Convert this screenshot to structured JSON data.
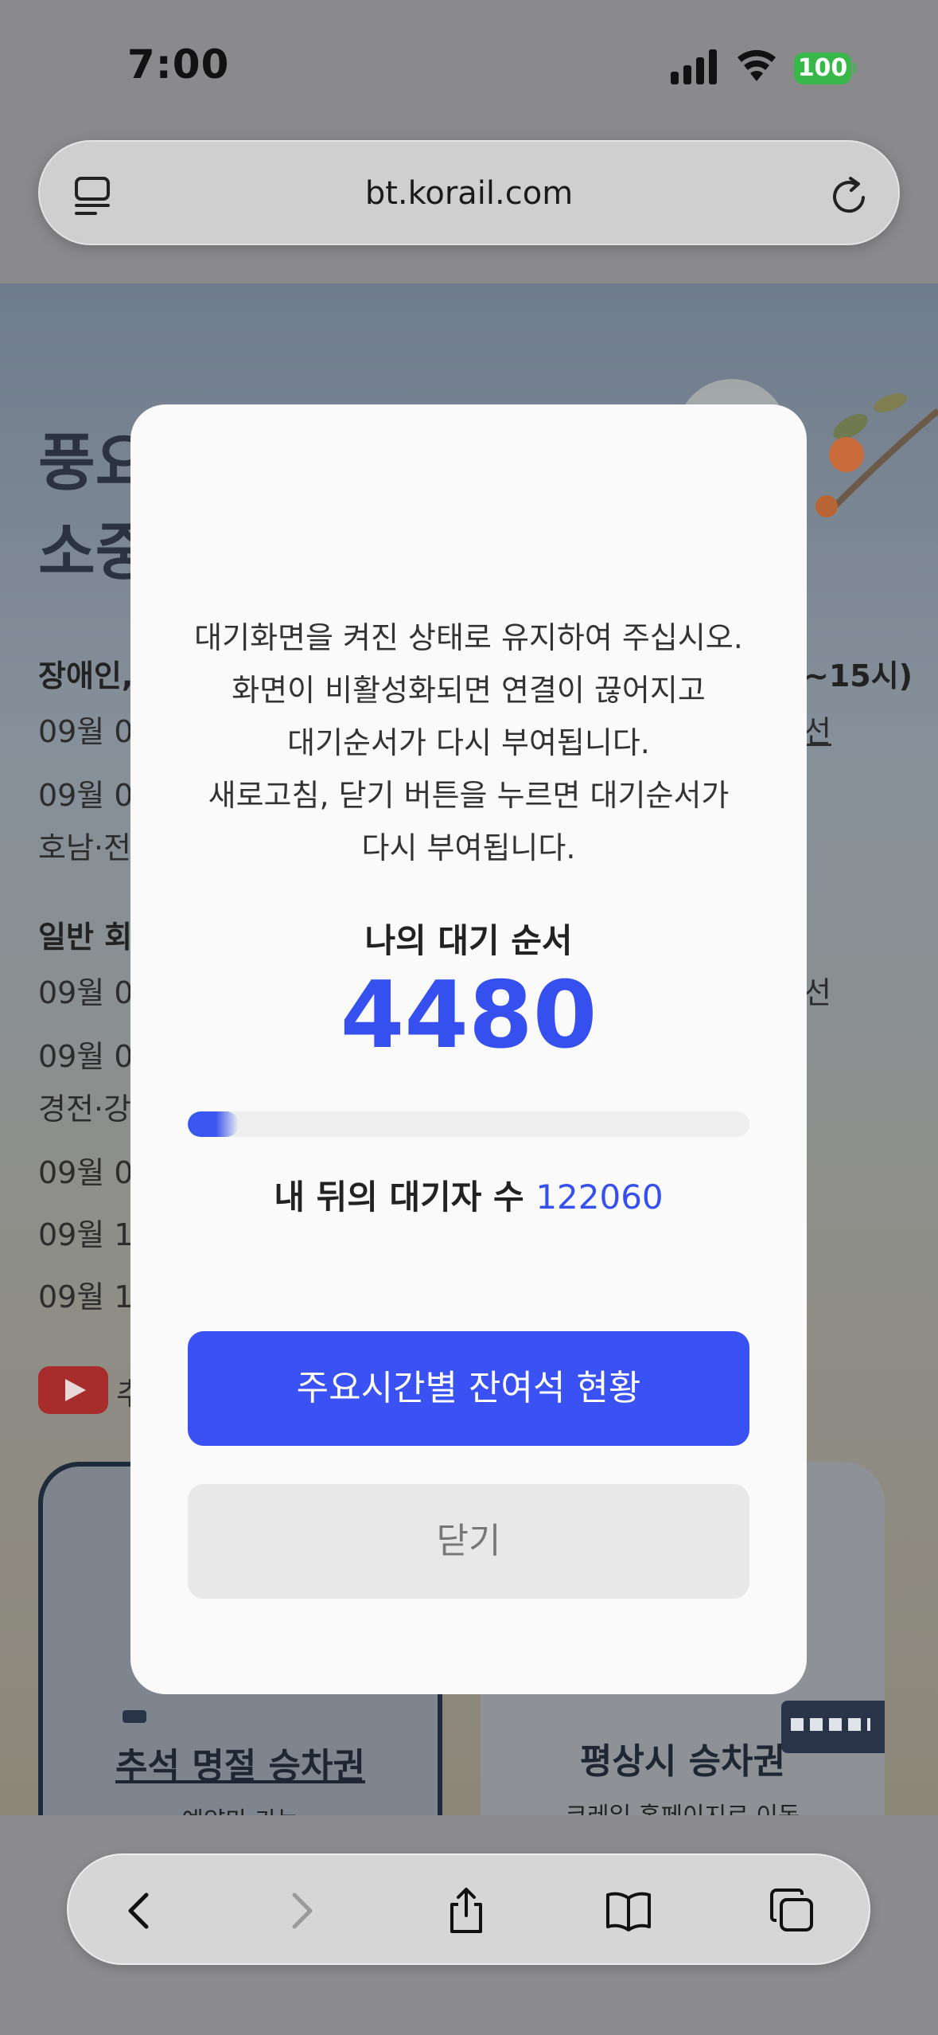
{
  "status_bar": {
    "time": "7:00",
    "battery": "100"
  },
  "browser": {
    "url": "bt.korail.com"
  },
  "background_page": {
    "hero_title_lines": [
      "풍요",
      "소중"
    ],
    "lines_left": [
      {
        "text": "장애인,",
        "bold": true
      },
      {
        "text": "09월 03",
        "bold": false
      },
      {
        "text": "09월 04",
        "bold": false
      },
      {
        "text": "호남·전",
        "bold": false
      },
      {
        "text": "일반 회",
        "bold": true
      },
      {
        "text": "09월 07",
        "bold": false
      },
      {
        "text": "09월 08",
        "bold": false
      },
      {
        "text": "경전·강",
        "bold": false
      },
      {
        "text": "09월 09",
        "bold": false
      },
      {
        "text": "09월 10",
        "bold": false
      },
      {
        "text": "09월 11",
        "bold": false
      }
    ],
    "lines_right": [
      "~15시)",
      "선",
      "선"
    ],
    "youtube_label": "추",
    "cards": [
      {
        "title": "추석 명절 승차권",
        "subtitle": "예약만 가능"
      },
      {
        "title": "평상시 승차권",
        "subtitle": "코레일 홈페이지로 이동"
      }
    ]
  },
  "modal": {
    "notice_lines": [
      "대기화면을 켜진 상태로 유지하여 주십시오.",
      "화면이 비활성화되면 연결이 끊어지고",
      "대기순서가 다시 부여됩니다.",
      "새로고침, 닫기 버튼을 누르면 대기순서가",
      "다시 부여됩니다."
    ],
    "my_order_label": "나의 대기 순서",
    "my_order_number": "4480",
    "progress_fraction": 0.09,
    "behind_label": "내 뒤의 대기자 수",
    "behind_count": "122060",
    "primary_button": "주요시간별 잔여석 현황",
    "close_button": "닫기"
  },
  "colors": {
    "accent": "#3a51f3",
    "battery": "#39b84a"
  },
  "toolbar_icons": [
    "back-icon",
    "forward-icon",
    "share-icon",
    "bookmarks-icon",
    "tabs-icon"
  ]
}
